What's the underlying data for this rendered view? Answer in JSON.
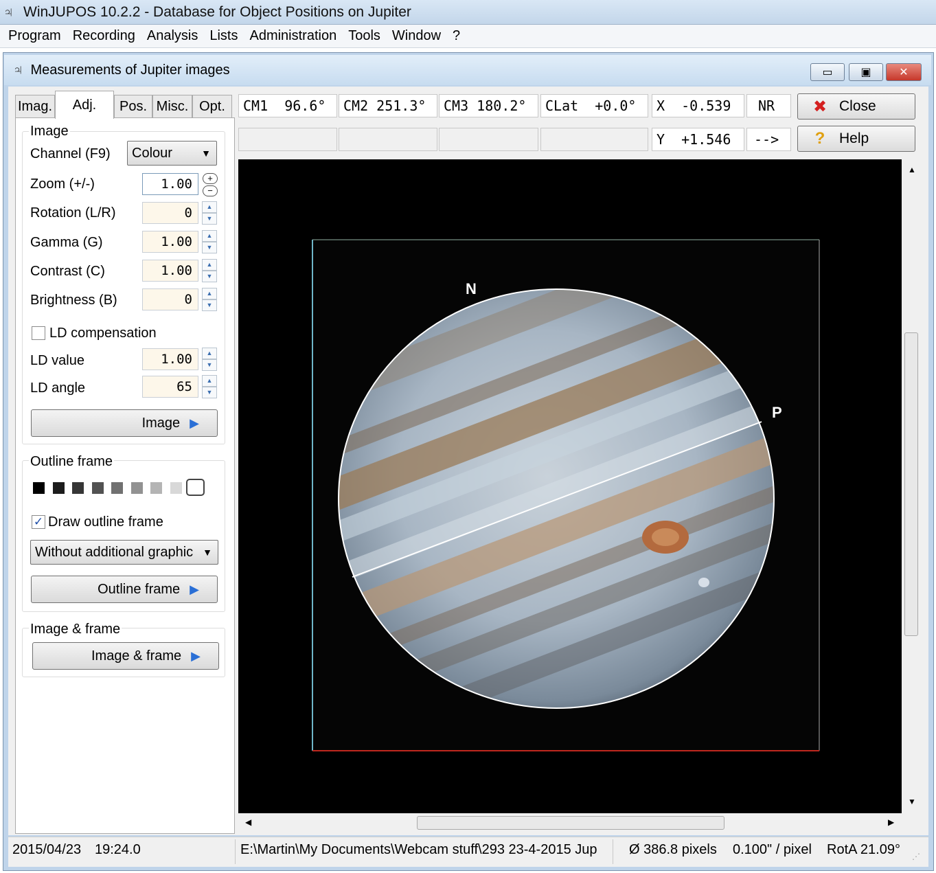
{
  "app": {
    "title": "WinJUPOS 10.2.2 - Database for Object Positions on Jupiter",
    "icon": "jupiter-app-icon"
  },
  "menu": [
    "Program",
    "Recording",
    "Analysis",
    "Lists",
    "Administration",
    "Tools",
    "Window",
    "?"
  ],
  "window": {
    "title": "Measurements of Jupiter images",
    "controls": [
      "minimize",
      "maximize",
      "close"
    ]
  },
  "tabs": [
    {
      "label": "Imag.",
      "active": false
    },
    {
      "label": "Adj.",
      "active": true
    },
    {
      "label": "Pos.",
      "active": false
    },
    {
      "label": "Misc.",
      "active": false
    },
    {
      "label": "Opt.",
      "active": false
    }
  ],
  "image_group": {
    "legend": "Image",
    "channel_label": "Channel (F9)",
    "channel_value": "Colour",
    "zoom_label": "Zoom (+/-)",
    "zoom_value": "1.00",
    "rotation_label": "Rotation (L/R)",
    "rotation_value": "0",
    "gamma_label": "Gamma (G)",
    "gamma_value": "1.00",
    "contrast_label": "Contrast (C)",
    "contrast_value": "1.00",
    "brightness_label": "Brightness (B)",
    "brightness_value": "0",
    "ld_comp_label": "LD compensation",
    "ld_comp_checked": false,
    "ld_value_label": "LD value",
    "ld_value": "1.00",
    "ld_angle_label": "LD angle",
    "ld_angle": "65",
    "button": "Image"
  },
  "outline_group": {
    "legend": "Outline frame",
    "swatches": [
      "#000000",
      "#1c1c1c",
      "#363636",
      "#525252",
      "#717171",
      "#929292",
      "#b4b4b4",
      "#d8d8d8",
      "#ffffff"
    ],
    "draw_label": "Draw outline frame",
    "draw_checked": true,
    "graphic_value": "Without additional graphic",
    "button": "Outline frame"
  },
  "image_frame_group": {
    "legend": "Image & frame",
    "button": "Image & frame"
  },
  "info": {
    "cm1_label": "CM1",
    "cm1_value": "96.6°",
    "cm2_label": "CM2",
    "cm2_value": "251.3°",
    "cm3_label": "CM3",
    "cm3_value": "180.2°",
    "clat_label": "CLat",
    "clat_value": "+0.0°",
    "x_label": "X",
    "x_value": "-0.539",
    "y_label": "Y",
    "y_value": "+1.546",
    "nr_label": "NR",
    "arrow_label": "-->"
  },
  "buttons": {
    "close": "Close",
    "help": "Help"
  },
  "overlay": {
    "north": "N",
    "preceding": "P"
  },
  "colors": {
    "planet_tan": "#b08a5e",
    "planet_blue": "#9fb3c6",
    "outline": "#ffffff",
    "frame_left": "#6fb7c9",
    "frame_bottom": "#c0281e"
  },
  "status": {
    "date": "2015/04/23",
    "time": "19:24.0",
    "path": "E:\\Martin\\My Documents\\Webcam stuff\\293 23-4-2015 Jup",
    "diameter": "Ø 386.8 pixels",
    "scale": "0.100\" / pixel",
    "rota": "RotA 21.09°"
  }
}
